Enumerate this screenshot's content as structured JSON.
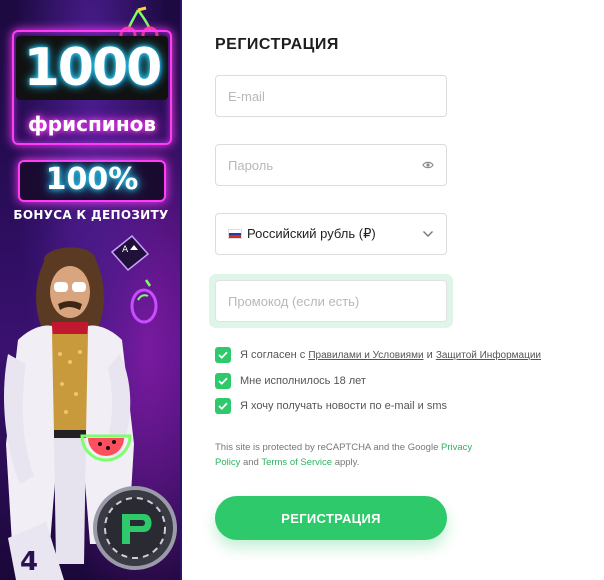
{
  "banner": {
    "free_spins_count": "1000",
    "free_spins_label": "фриспинов",
    "bonus_percent": "100%",
    "bonus_label": "БОНУСА К ДЕПОЗИТУ"
  },
  "form": {
    "title": "РЕГИСТРАЦИЯ",
    "email": {
      "placeholder": "E-mail",
      "value": ""
    },
    "password": {
      "placeholder": "Пароль",
      "value": ""
    },
    "currency": {
      "selected": "Российский рубль (₽)",
      "flag": "ru"
    },
    "promo": {
      "placeholder": "Промокод (если есть)",
      "value": ""
    },
    "checkboxes": [
      {
        "checked": true,
        "text_prefix": "Я согласен с ",
        "link1": "Правилами и Условиями",
        "middle": " и ",
        "link2": "Защитой Информации"
      },
      {
        "checked": true,
        "text": "Мне исполнилось 18 лет"
      },
      {
        "checked": true,
        "text": "Я хочу получать новости по e-mail и sms"
      }
    ],
    "recaptcha": {
      "text1": "This site is protected by reCAPTCHA and the Google ",
      "privacy_link": "Privacy Policy",
      "and": " and ",
      "terms_link": "Terms of Service",
      "suffix": " apply."
    },
    "submit_label": "РЕГИСТРАЦИЯ"
  },
  "colors": {
    "accent": "#2dc96b",
    "promo_highlight": "#dff5e7",
    "banner_bg": "#2a0d5a",
    "neon_pink": "#ff3df5",
    "neon_cyan": "#29d6ff"
  }
}
